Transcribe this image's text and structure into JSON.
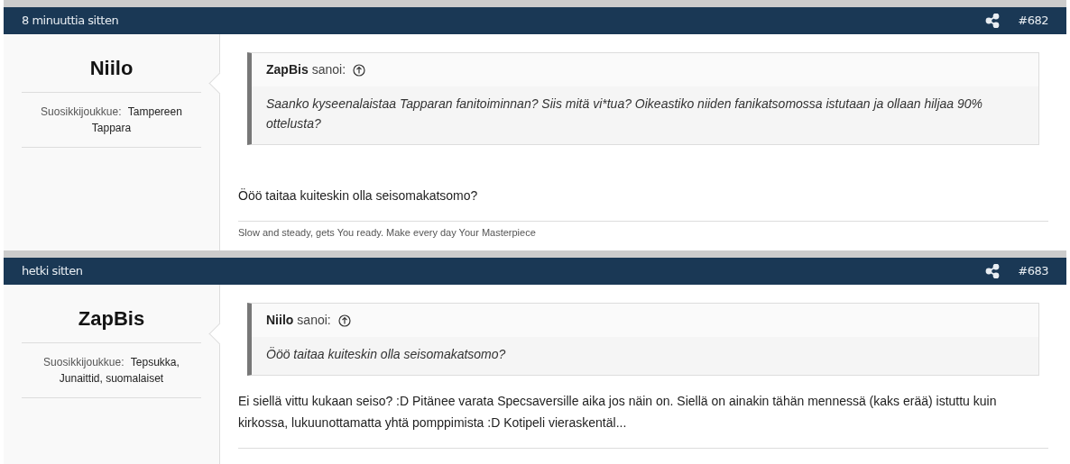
{
  "posts": [
    {
      "time": "8 minuuttia sitten",
      "number": "#682",
      "author": "Niilo",
      "team_label": "Suosikkijoukkue:",
      "team": "Tampereen Tappara",
      "quote": {
        "author": "ZapBis",
        "said": "sanoi:",
        "text": "Saanko kyseenalaistaa Tapparan fanitoiminnan? Siis mitä vi*tua? Oikeastiko niiden fanikatsomossa istutaan ja ollaan hiljaa 90% ottelusta?"
      },
      "message": "Ööö taitaa kuiteskin olla seisomakatsomo?",
      "signature": "Slow and steady, gets You ready. Make every day Your Masterpiece"
    },
    {
      "time": "hetki sitten",
      "number": "#683",
      "author": "ZapBis",
      "team_label": "Suosikkijoukkue:",
      "team": "Tepsukka, Junaittid, suomalaiset",
      "quote": {
        "author": "Niilo",
        "said": "sanoi:",
        "text": "Ööö taitaa kuiteskin olla seisomakatsomo?"
      },
      "message": "Ei siellä vittu kukaan seiso? :D Pitänee varata Specsaversille aika jos näin on. Siellä on ainakin tähän mennessä (kaks erää) istuttu kuin kirkossa, lukuunottamatta yhtä pomppimista :D Kotipeli vieraskentäl..."
    }
  ]
}
